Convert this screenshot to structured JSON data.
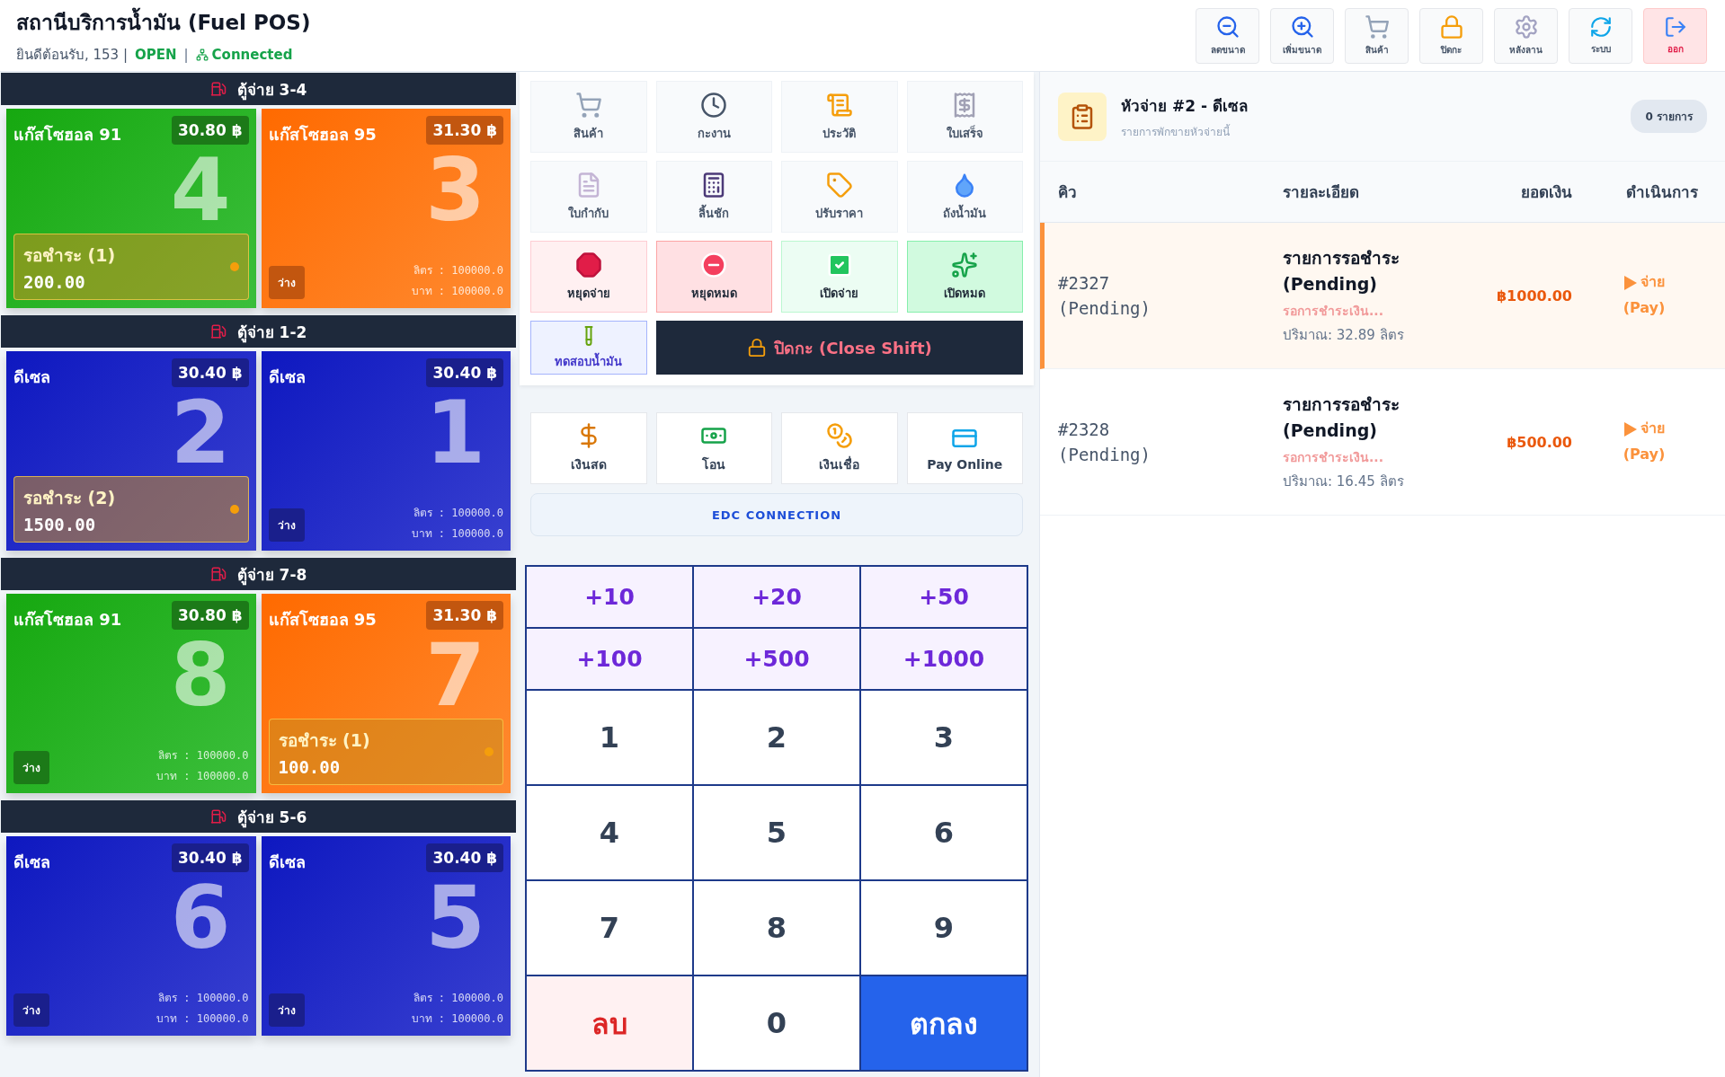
{
  "header": {
    "title": "สถานีบริการน้ำมัน (Fuel POS)",
    "welcome": "ยินดีต้อนรับ, 153 |",
    "status": "OPEN",
    "separator": "|",
    "connection": "Connected",
    "tools": [
      {
        "kind": "zoom_out",
        "label": "ลดขนาด"
      },
      {
        "kind": "zoom_in",
        "label": "เพิ่มขนาด"
      },
      {
        "kind": "product",
        "label": "สินค้า"
      },
      {
        "kind": "lock",
        "label": "ปิดกะ"
      },
      {
        "kind": "settings",
        "label": "หลังลาน"
      },
      {
        "kind": "system",
        "label": "ระบบ"
      },
      {
        "kind": "logout",
        "label": "ออก"
      }
    ]
  },
  "pump_groups": [
    {
      "title": "ตู้จ่าย 3-4",
      "pumps": [
        {
          "fuel": "แก๊สโซฮอล 91",
          "kind": "g91",
          "price": "30.80 ฿",
          "number": "4",
          "pending": true,
          "pending_label": "รอชำระ (1)",
          "pending_amount": "200.00"
        },
        {
          "fuel": "แก๊สโซฮอล 95",
          "kind": "g95",
          "price": "31.30 ฿",
          "number": "3",
          "pending": false,
          "idle_label": "ว่าง",
          "liters": "ลิตร : 100000.0",
          "baht": "บาท : 100000.0"
        }
      ]
    },
    {
      "title": "ตู้จ่าย 1-2",
      "pumps": [
        {
          "fuel": "ดีเซล",
          "kind": "diesel",
          "price": "30.40 ฿",
          "number": "2",
          "pending": true,
          "pending_label": "รอชำระ (2)",
          "pending_amount": "1500.00"
        },
        {
          "fuel": "ดีเซล",
          "kind": "diesel",
          "price": "30.40 ฿",
          "number": "1",
          "pending": false,
          "idle_label": "ว่าง",
          "liters": "ลิตร : 100000.0",
          "baht": "บาท : 100000.0"
        }
      ]
    },
    {
      "title": "ตู้จ่าย 7-8",
      "pumps": [
        {
          "fuel": "แก๊สโซฮอล 91",
          "kind": "g91",
          "price": "30.80 ฿",
          "number": "8",
          "pending": false,
          "idle_label": "ว่าง",
          "liters": "ลิตร : 100000.0",
          "baht": "บาท : 100000.0"
        },
        {
          "fuel": "แก๊สโซฮอล 95",
          "kind": "g95",
          "price": "31.30 ฿",
          "number": "7",
          "pending": true,
          "pending_label": "รอชำระ (1)",
          "pending_amount": "100.00"
        }
      ]
    },
    {
      "title": "ตู้จ่าย 5-6",
      "pumps": [
        {
          "fuel": "ดีเซล",
          "kind": "diesel",
          "price": "30.40 ฿",
          "number": "6",
          "pending": false,
          "idle_label": "ว่าง",
          "liters": "ลิตร : 100000.0",
          "baht": "บาท : 100000.0"
        },
        {
          "fuel": "ดีเซล",
          "kind": "diesel",
          "price": "30.40 ฿",
          "number": "5",
          "pending": false,
          "idle_label": "ว่าง",
          "liters": "ลิตร : 100000.0",
          "baht": "บาท : 100000.0"
        }
      ]
    }
  ],
  "actions": [
    {
      "kind": "product",
      "label": "สินค้า"
    },
    {
      "kind": "shift",
      "label": "กะงาน"
    },
    {
      "kind": "history",
      "label": "ประวัติ"
    },
    {
      "kind": "receipt",
      "label": "ใบเสร็จ"
    },
    {
      "kind": "invoice",
      "label": "ใบกำกับ"
    },
    {
      "kind": "drawer",
      "label": "ลิ้นชัก"
    },
    {
      "kind": "price",
      "label": "ปรับราคา"
    },
    {
      "kind": "tank",
      "label": "ถังน้ำมัน"
    },
    {
      "kind": "stop",
      "label": "หยุดจ่าย"
    },
    {
      "kind": "stop_all",
      "label": "หยุดหมด"
    },
    {
      "kind": "open",
      "label": "เปิดจ่าย"
    },
    {
      "kind": "open_all",
      "label": "เปิดหมด"
    },
    {
      "kind": "test",
      "label": "ทดสอบน้ำมัน"
    },
    {
      "kind": "close_shift",
      "label": "ปิดกะ (Close Shift)"
    }
  ],
  "payments": [
    {
      "kind": "cash",
      "label": "เงินสด"
    },
    {
      "kind": "transfer",
      "label": "โอน"
    },
    {
      "kind": "credit",
      "label": "เงินเชื่อ"
    },
    {
      "kind": "online",
      "label": "Pay Online"
    }
  ],
  "edc": "EDC CONNECTION",
  "keypad": [
    {
      "kind": "quick",
      "label": "+10"
    },
    {
      "kind": "quick",
      "label": "+20"
    },
    {
      "kind": "quick",
      "label": "+50"
    },
    {
      "kind": "quick",
      "label": "+100"
    },
    {
      "kind": "quick",
      "label": "+500"
    },
    {
      "kind": "quick",
      "label": "+1000"
    },
    {
      "kind": "digit",
      "label": "1"
    },
    {
      "kind": "digit",
      "label": "2"
    },
    {
      "kind": "digit",
      "label": "3"
    },
    {
      "kind": "digit",
      "label": "4"
    },
    {
      "kind": "digit",
      "label": "5"
    },
    {
      "kind": "digit",
      "label": "6"
    },
    {
      "kind": "digit",
      "label": "7"
    },
    {
      "kind": "digit",
      "label": "8"
    },
    {
      "kind": "digit",
      "label": "9"
    },
    {
      "kind": "delete",
      "label": "ลบ"
    },
    {
      "kind": "digit",
      "label": "0"
    },
    {
      "kind": "confirm",
      "label": "ตกลง"
    }
  ],
  "pending_panel": {
    "title": "หัวจ่าย #2 - ดีเซล",
    "subtitle": "รายการพักขายหัวจ่ายนี้",
    "count": "0 รายการ",
    "columns": [
      "คิว",
      "รายละเอียด",
      "ยอดเงิน",
      "ดำเนินการ"
    ],
    "rows": [
      {
        "queue": "#2327 (Pending)",
        "title": "รายการรอชำระ (Pending)",
        "status": "รอการชำระเงิน...",
        "quantity": "ปริมาณ: 32.89 ลิตร",
        "amount": "฿1000.00",
        "action": "จ่าย (Pay)",
        "selected": true
      },
      {
        "queue": "#2328 (Pending)",
        "title": "รายการรอชำระ (Pending)",
        "status": "รอการชำระเงิน...",
        "quantity": "ปริมาณ: 16.45 ลิตร",
        "amount": "฿500.00",
        "action": "จ่าย (Pay)",
        "selected": false
      }
    ]
  }
}
